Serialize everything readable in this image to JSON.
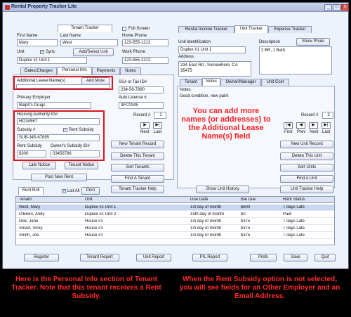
{
  "window": {
    "title": "Rental Property Tracker Lite",
    "controls": [
      "_",
      "□",
      "X"
    ]
  },
  "header": {
    "tenant_tracker": "Tenant Tracker",
    "full_screen": "Full Screen",
    "rental_income_tracker": "Rental Income Tracker",
    "unit_tracker": "Unit Tracker",
    "expense_tracker": "Expense Tracker"
  },
  "tenant": {
    "first_name_label": "First Name",
    "first_name": "Mary",
    "last_name_label": "Last Name",
    "last_name": "West",
    "home_phone_label": "Home Phone",
    "home_phone": "123-555-1212",
    "unit_label": "Unit",
    "sync_label": "Sync",
    "add_select_unit": "Add/Select Unit",
    "unit_value": "Duplex #1 Unit 1",
    "work_phone_label": "Work Phone",
    "work_phone": "123-555-1212",
    "tabs": [
      "Dates/Charges",
      "Personal Info",
      "Payments",
      "Notes"
    ],
    "additional_lease_label": "Additional Lease Name(s)",
    "add_more": "Add More",
    "ssn_label": "SS# or Tax ID#",
    "ssn": "234-56-7890",
    "primary_employer_label": "Primary Employer",
    "primary_employer": "Ralph's Drugs",
    "auto_license_label": "Auto License #",
    "auto_license": "3FC0345",
    "housing_authority_label": "Housing Authority ID#",
    "housing_authority": "HI234567",
    "subsidy_label": "Subsidy #",
    "subsidy": "SUB-345-67895",
    "rent_subsidy_label": "Rent Subsidy",
    "rent_subsidy_amount_label": "Rent Subsidy",
    "rent_subsidy_amount": "$300",
    "owner_subsidy_label": "Owner's Subsidy ID#",
    "owner_subsidy": "03456786",
    "record_label": "Record #",
    "record_value": "1",
    "next_label": "Next",
    "last_label": "Last",
    "late_notice": "Late Notice",
    "tenant_notice": "Tenant Notice",
    "post_new_rent": "Post New Rent",
    "new_tenant_record": "New Tenant Record",
    "delete_this_tenant": "Delete This Tenant",
    "sort_tenants": "Sort Tenants",
    "find_a_tenant": "Find A Tenant",
    "tenant_tracker_help": "Tenant Tracker Help"
  },
  "unit": {
    "identification_label": "Unit Identification",
    "identification": "Duplex #1 Unit 1",
    "description_label": "Description",
    "description": "2 BR, 1 Bath",
    "show_photo": "Show Photo",
    "address_label": "Address",
    "address_line1": "234 East Rd , Somewhere, CA",
    "address_line2": "95475",
    "tabs": [
      "Tenant",
      "Notes",
      "Owner/Manager",
      "Unit Cost"
    ],
    "notes_label": "Notes",
    "notes": "Good condition, new paint",
    "record_label": "Record #",
    "record_value": "2",
    "nav": [
      "First",
      "Prev",
      "Next",
      "Last"
    ],
    "new_unit_record": "New Unit Record",
    "delete_this_unit": "Delete This Unit",
    "sort_units": "Sort Units",
    "find_a_unit": "Find A Unit",
    "unit_tracker_help": "Unit Tracker Help",
    "show_unit_history": "Show Unit History"
  },
  "rent_roll": {
    "tab_label": "Rent Roll",
    "list_all": "List All",
    "print": "Print",
    "columns": [
      "Tenant",
      "Unit",
      "Due Date",
      "Bal Due",
      "Rent Status"
    ],
    "rows": [
      [
        "West, Mary",
        "Duplex #1 Unit 1",
        "1st day of month",
        "$600",
        "7 days Late"
      ],
      [
        "O'Brien, Andy",
        "Duplex #1 Unit 2",
        "15th day of month",
        "$0",
        "Paid"
      ],
      [
        "Doe, Jane",
        "House #1",
        "1st day of month",
        "$375",
        "7 days Late"
      ],
      [
        "Smart, Vicky",
        "House #1",
        "1st day of month",
        "$375",
        "7 days Late"
      ],
      [
        "Smith, Joe",
        "House #1",
        "1st day of month",
        "$375",
        "7 days Late"
      ]
    ]
  },
  "footer_buttons": [
    "Register",
    "Tenant Report",
    "Unit Report",
    "P/L Report",
    "Prefs",
    "Save",
    "Quit"
  ],
  "annotations": {
    "center": "You can add more names (or addresses) to the Additional Lease Name(s) field",
    "bottom_left": "Here is the Personal Info section of Tenant Tracker. Note that this tenant receives a Rent Subsidy.",
    "bottom_right": "When the Rent Subsidy option is not selected, you will see fields for an Other Employer and an Email Address."
  },
  "colors": {
    "highlight_red": "#e0141b",
    "window_bg": "#eef2fb",
    "caption_red": "#ff2b2b"
  }
}
